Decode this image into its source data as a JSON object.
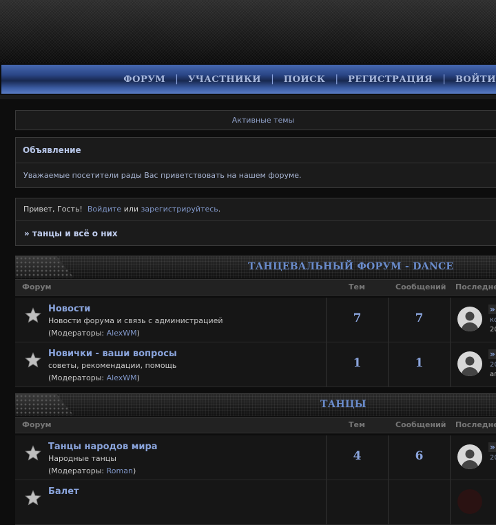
{
  "nav": {
    "items": [
      "ФОРУМ",
      "УЧАСТНИКИ",
      "ПОИСК",
      "РЕГИСТРАЦИЯ",
      "ВОЙТИ"
    ],
    "separator": "|"
  },
  "active_topics": "Активные темы",
  "announcement": {
    "title": "Объявление",
    "text": "Уважаемые посетители рады Вас приветствовать на нашем форуме."
  },
  "greeting": {
    "prefix": "Привет, Гость!",
    "login": "Войдите",
    "or": "или",
    "register": "зарегистрируйтесь",
    "period": "."
  },
  "breadcrumb": "» танцы и всё о них",
  "columns": {
    "forum": "Форум",
    "topics": "Тем",
    "posts": "Сообщений",
    "last": "Последнее"
  },
  "categories": [
    {
      "title": "ТАНЦЕВАЛЬНЫЙ ФОРУМ - DANCE",
      "forums": [
        {
          "title": "Новости",
          "desc": "Новости форума и связь с администрацией",
          "mods_prefix": "(Модераторы: ",
          "mod": "AlexWM",
          "mods_suffix": ")",
          "topics": "7",
          "posts": "7",
          "last_arrow": "»",
          "last_l1": "ко",
          "last_l2": "20"
        },
        {
          "title": "Новички - ваши вопросы",
          "desc": "советы, рекомендации, помощь",
          "mods_prefix": "(Модераторы: ",
          "mod": "AlexWM",
          "mods_suffix": ")",
          "topics": "1",
          "posts": "1",
          "last_arrow": "»",
          "last_l1": "20",
          "last_l2": "ап"
        }
      ]
    },
    {
      "title": "ТАНЦЫ",
      "forums": [
        {
          "title": "Танцы народов мира",
          "desc": "Народные танцы",
          "mods_prefix": "(Модераторы: ",
          "mod": "Roman",
          "mods_suffix": ")",
          "topics": "4",
          "posts": "6",
          "last_arrow": "»",
          "last_l1": "20",
          "last_l2": ""
        },
        {
          "title": "Балет",
          "desc": "",
          "mods_prefix": "",
          "mod": "",
          "mods_suffix": "",
          "topics": "",
          "posts": "",
          "last_arrow": "",
          "last_l1": "",
          "last_l2": ""
        }
      ]
    }
  ],
  "colors": {
    "accent": "#8aa4dc",
    "nav_blue": "#2a4585",
    "background": "#0d0d0d"
  }
}
